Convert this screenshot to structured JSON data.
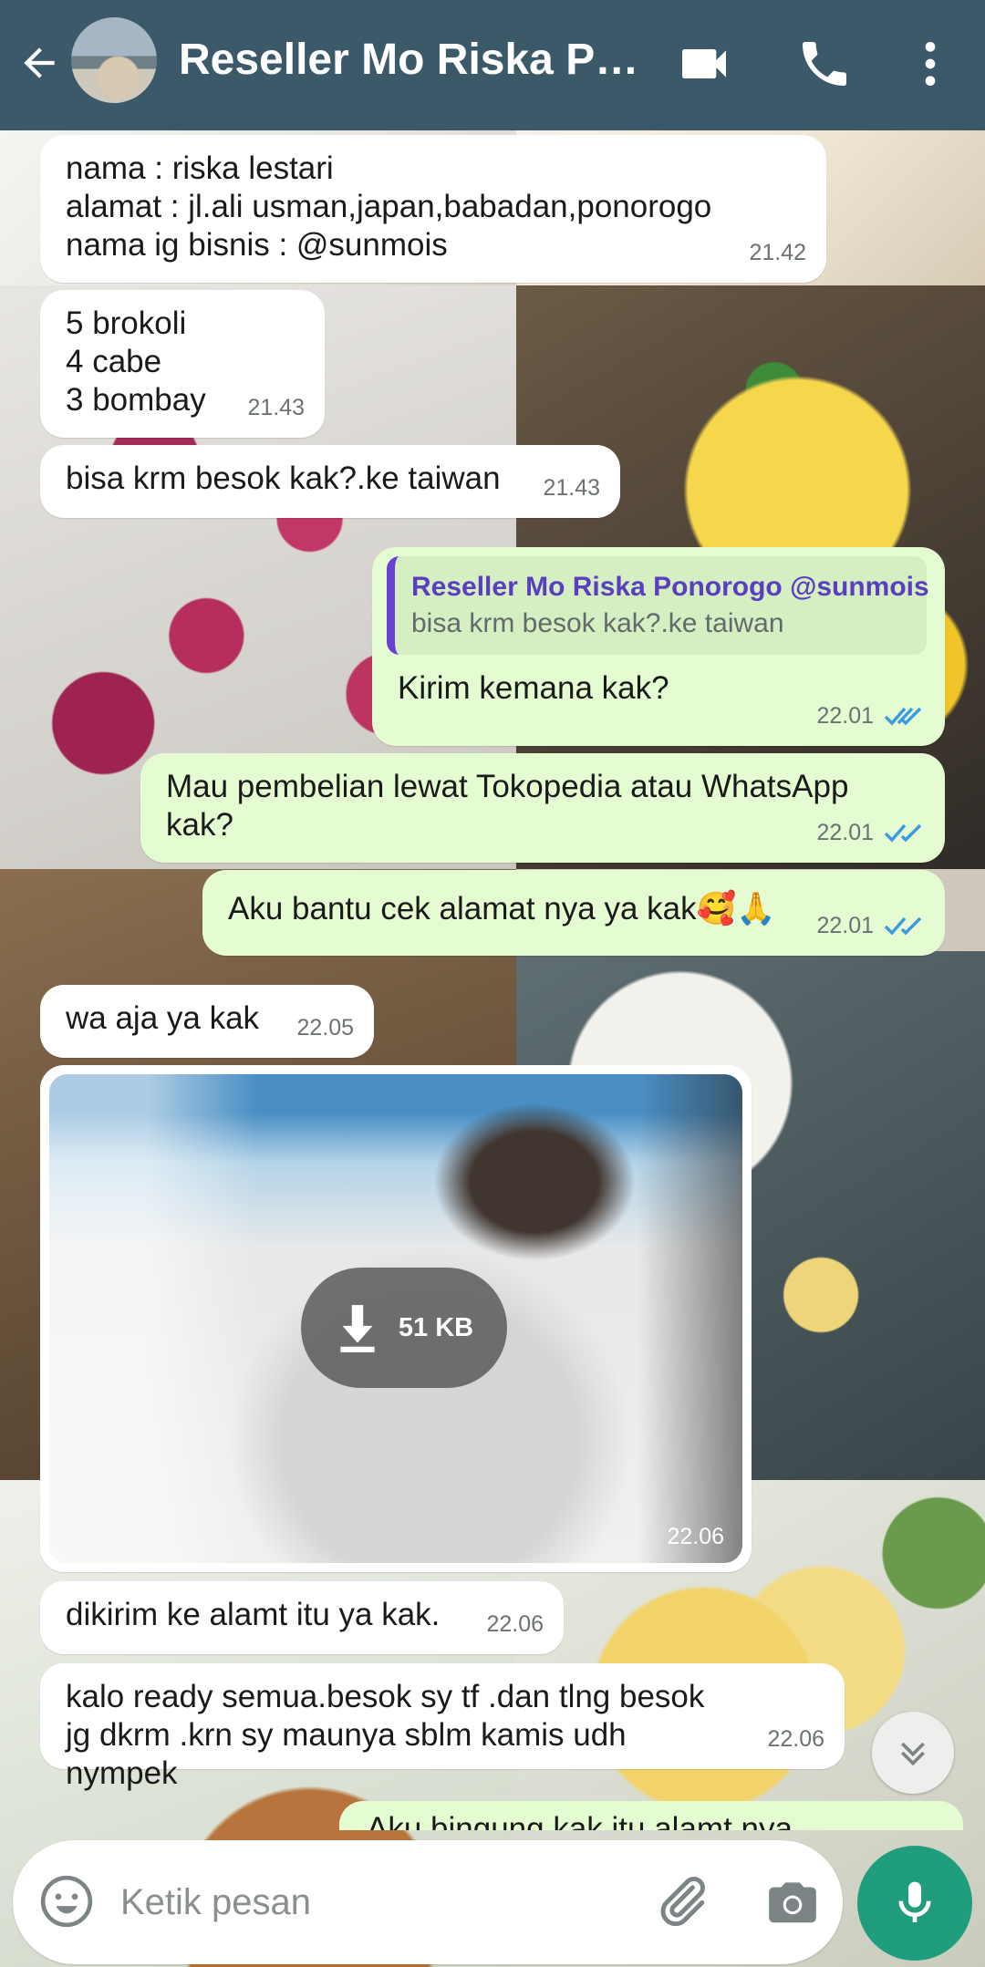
{
  "header": {
    "title": "Reseller Mo Riska Ponorogo @sunmois"
  },
  "messages": {
    "m1": {
      "text": "nama : riska lestari\nalamat : jl.ali usman,japan,babadan,ponorogo\nnama ig bisnis : @sunmois",
      "time": "21.42"
    },
    "m2": {
      "text": "5 brokoli\n4 cabe\n3 bombay",
      "time": "21.43"
    },
    "m3": {
      "text": "bisa krm besok kak?.ke taiwan",
      "time": "21.43"
    },
    "m4": {
      "quote_name": "Reseller Mo Riska Ponorogo @sunmois",
      "quote_text": "bisa krm besok kak?.ke taiwan",
      "text": "Kirim kemana kak?",
      "time": "22.01"
    },
    "m5": {
      "text": "Mau pembelian lewat Tokopedia atau WhatsApp kak?",
      "time": "22.01"
    },
    "m6": {
      "text": "Aku bantu cek alamat nya ya kak🥰🙏",
      "time": "22.01"
    },
    "m7": {
      "text": "wa aja ya kak",
      "time": "22.05"
    },
    "m8": {
      "size": "51 KB",
      "time": "22.06"
    },
    "m9": {
      "text": "dikirim ke alamt itu ya kak.",
      "time": "22.06"
    },
    "m10": {
      "text": "kalo ready semua.besok sy tf .dan tlng besok jg dkrm .krn sy maunya sblm kamis udh nympek",
      "time": "22.06"
    },
    "m11": {
      "text": "Aku bingung kak itu alamt nya"
    }
  },
  "composer": {
    "placeholder": "Ketik pesan"
  },
  "colors": {
    "header": "#3b5968",
    "outgoing_bubble": "#e5fbd2",
    "incoming_bubble": "#ffffff",
    "mic_button": "#1f9d7c",
    "read_ticks": "#3b9be0",
    "quote_bar": "#6b3fd0"
  },
  "icons": [
    "back-arrow-icon",
    "video-call-icon",
    "voice-call-icon",
    "more-options-icon",
    "double-check-icon",
    "download-icon",
    "scroll-down-icon",
    "emoji-icon",
    "attach-icon",
    "camera-icon",
    "mic-icon"
  ]
}
